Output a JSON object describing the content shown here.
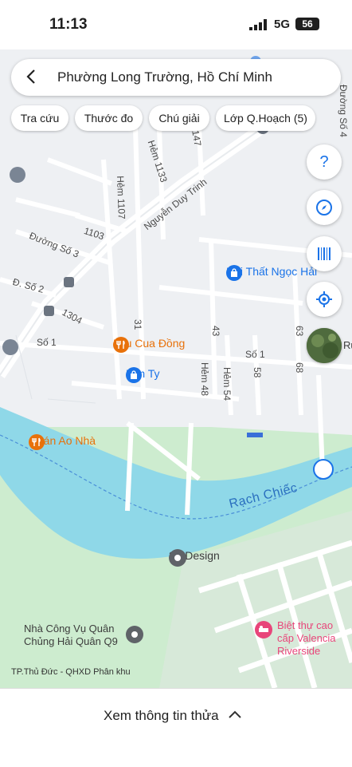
{
  "status_bar": {
    "time": "11:13",
    "network": "5G",
    "battery": "56"
  },
  "search": {
    "location": "Phường Long Trường, Hồ Chí Minh"
  },
  "chips": [
    {
      "label": "Tra cứu"
    },
    {
      "label": "Thước đo"
    },
    {
      "label": "Chú giải"
    },
    {
      "label": "Lớp Q.Hoạch (5)"
    }
  ],
  "map": {
    "water_color": "#8fd8e8",
    "park_color": "#cdeccf",
    "road_labels": [
      "Nguyễn Duy Trinh",
      "Hẻm 1133",
      "Hẻm 1107",
      "147",
      "1103",
      "Đường Số 3",
      "Đ. Số 2",
      "1304",
      "Số 1",
      "Số 1",
      "31",
      "43",
      "63",
      "68",
      "58",
      "Hẻm 48",
      "Hẻm 54",
      "Đường Số 4"
    ],
    "pois": [
      {
        "name": "Lẩu Cua Đồng",
        "icon": "restaurant-icon",
        "color": "#e8710a"
      },
      {
        "name": "Kim Ty",
        "icon": "shopping-bag-icon",
        "color": "#1a73e8"
      },
      {
        "name": "Quán Ao Nhà",
        "icon": "restaurant-icon",
        "color": "#e8710a"
      },
      {
        "name": "3A Design",
        "icon": "place-icon",
        "color": "#5f6368"
      },
      {
        "name": "Nội Thất Ngọc Hải",
        "icon": "shopping-bag-icon",
        "color": "#1a73e8"
      },
      {
        "name": "Nhà Công Vụ Quân Chủng Hải Quân Q9",
        "icon": "place-icon",
        "color": "#5f6368"
      },
      {
        "name": "Biệt thự cao cấp Valencia Riverside",
        "icon": "hotel-icon",
        "color": "#e8457a"
      }
    ],
    "water_label": "Rạch Chiếc",
    "edge_label": "Ru",
    "attribution": "TP.Thủ Đức - QHXD Phân khu"
  },
  "bottom_sheet": {
    "label": "Xem thông tin thửa"
  }
}
